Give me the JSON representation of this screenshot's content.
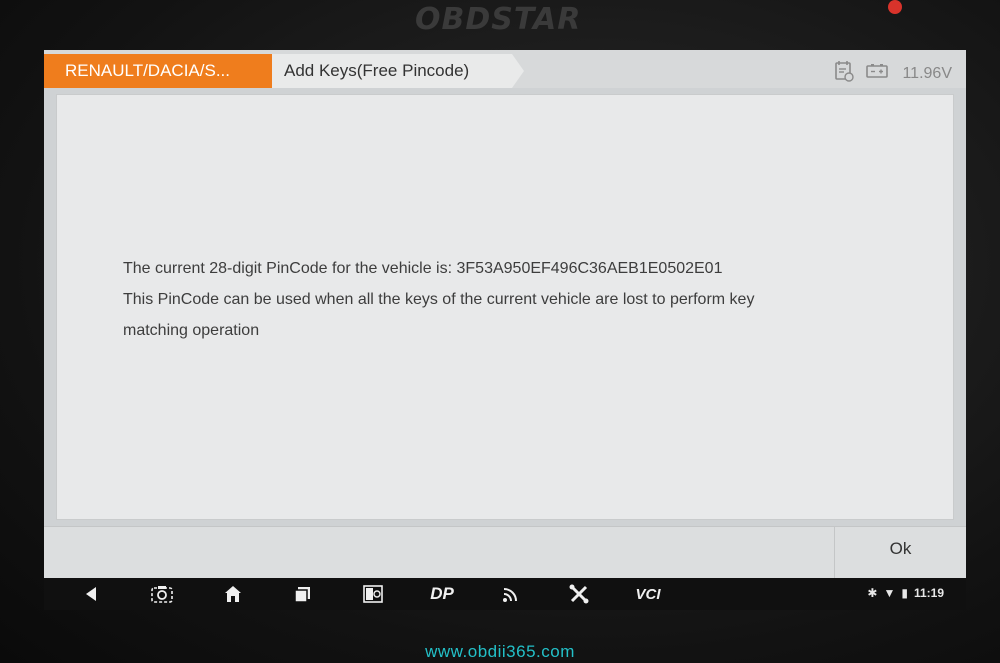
{
  "device": {
    "brand": "OBDSTAR"
  },
  "tabs": [
    {
      "label": "RENAULT/DACIA/S..."
    },
    {
      "label": "Add Keys(Free Pincode)"
    }
  ],
  "status": {
    "voltage": "11.96V",
    "time": "11:19"
  },
  "message": {
    "line1": "The current 28-digit PinCode for the vehicle is: 3F53A950EF496C36AEB1E0502E01",
    "line2": "This PinCode can be used when all the keys of the current vehicle are lost to perform key",
    "line3": "matching operation"
  },
  "buttons": {
    "ok": "Ok"
  },
  "navbar": {
    "dp_label": "DP",
    "vci_label": "VCI"
  },
  "footer": {
    "watermark": "www.obdii365.com"
  },
  "colors": {
    "accent": "#ef7d1d",
    "watermark": "#23c0c8"
  }
}
